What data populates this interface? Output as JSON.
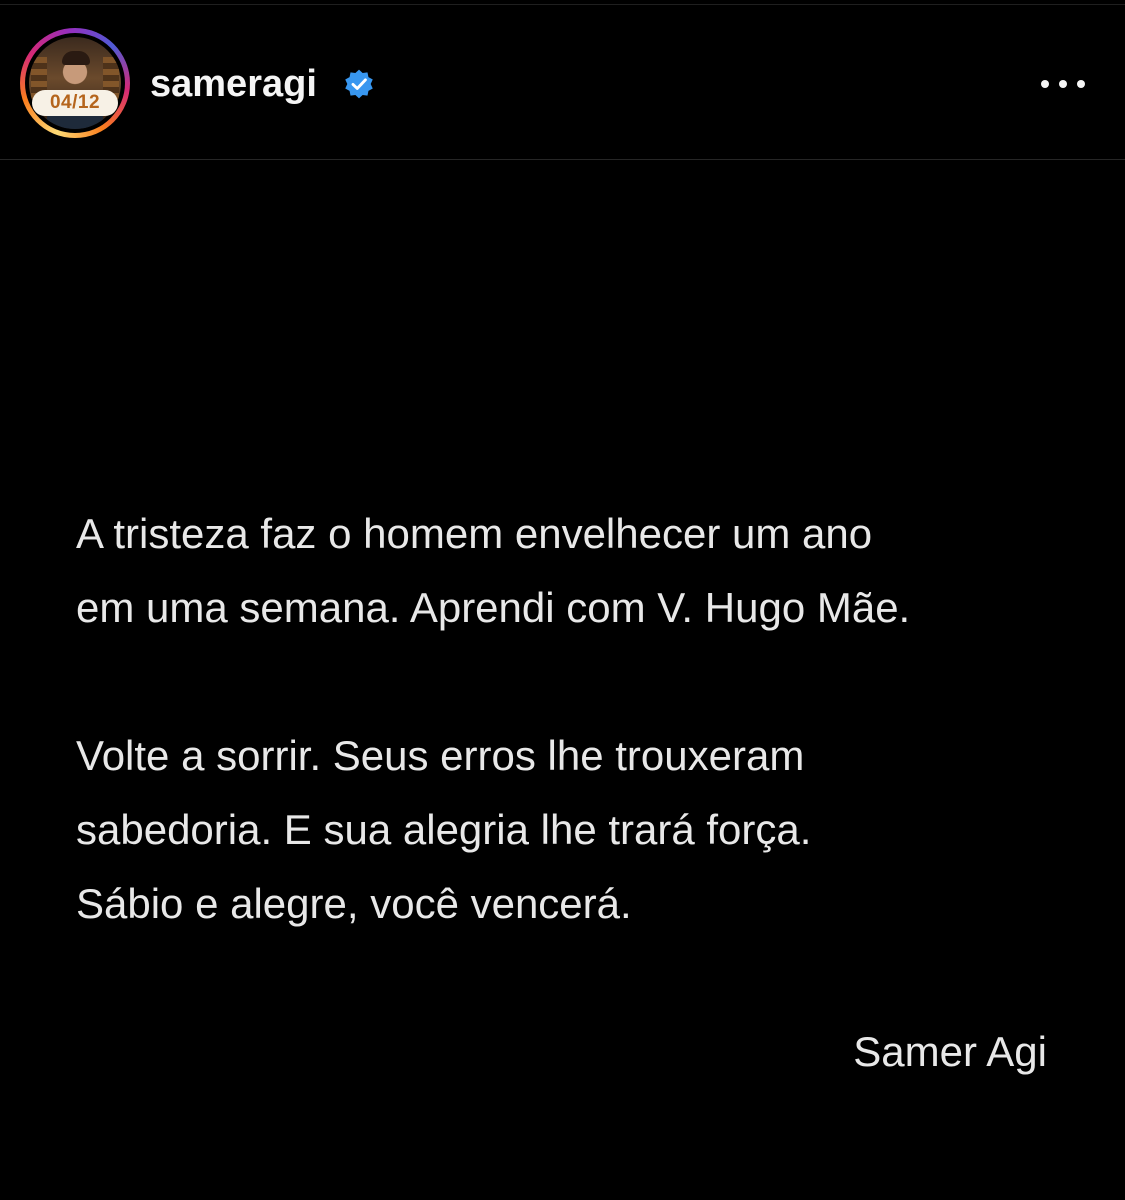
{
  "header": {
    "username": "sameragi",
    "avatar_badge": "04/12",
    "verified_icon": "verified-badge-icon",
    "more_icon": "more-horizontal-icon",
    "colors": {
      "verified": "#3897f0",
      "background": "#000000",
      "text": "#f5f5f5"
    }
  },
  "post": {
    "paragraphs": [
      [
        "A tristeza faz o homem envelhecer um ano",
        "em uma semana. Aprendi com V. Hugo Mãe."
      ],
      [
        "Volte a sorrir. Seus erros lhe trouxeram",
        "sabedoria. E sua alegria lhe trará força.",
        "Sábio e alegre, você vencerá."
      ]
    ],
    "signature": "Samer Agi"
  }
}
